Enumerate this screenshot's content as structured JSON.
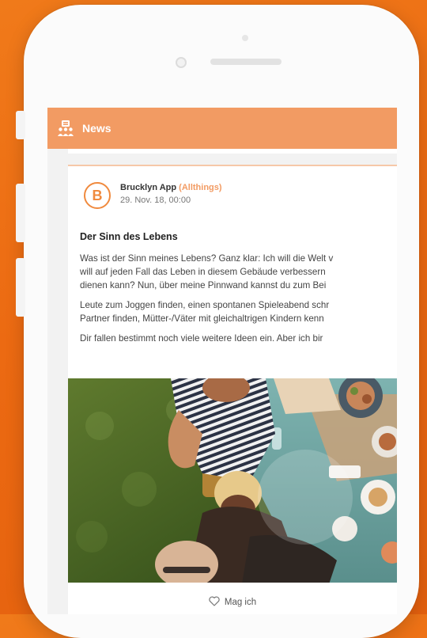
{
  "header": {
    "title": "News",
    "icon": "people-group-icon"
  },
  "post": {
    "avatar_letter": "B",
    "author": "Brucklyn App",
    "author_tag": "(Allthings)",
    "date": "29. Nov. 18, 00:00",
    "title": "Der Sinn des Lebens",
    "paragraphs": [
      [
        "Was ist der Sinn meines Lebens? Ganz klar: Ich will die Welt v",
        "will auf jeden Fall das Leben in diesem Gebäude verbessern",
        "dienen kann? Nun, über meine Pinnwand kannst du zum Bei"
      ],
      [
        "Leute zum Joggen finden, einen spontanen Spieleabend schr",
        "Partner finden, Mütter-/Väter mit gleichaltrigen Kindern kenn"
      ],
      [
        "Dir fallen bestimmt noch viele weitere Ideen ein. Aber ich bir"
      ]
    ],
    "image_icon": "outdoor-dinner-party-photo",
    "like_label": "Mag ich",
    "like_icon": "heart-outline-icon"
  },
  "colors": {
    "background": "#ec6a12",
    "header": "#f29b63",
    "accent": "#f08a3e"
  }
}
